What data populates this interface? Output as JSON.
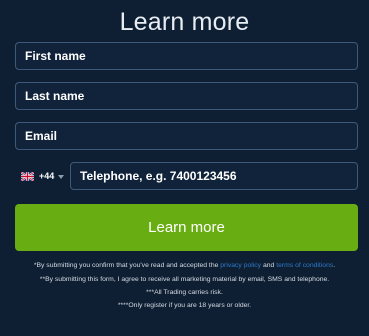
{
  "title": "Learn more",
  "form": {
    "first_name_placeholder": "First name",
    "last_name_placeholder": "Last name",
    "email_placeholder": "Email",
    "country_dial_code": "+44",
    "telephone_placeholder": "Telephone, e.g. 7400123456"
  },
  "submit_label": "Learn more",
  "disclaimer": {
    "line1_prefix": "*By submitting you confirm that you've read and accepted the ",
    "privacy_policy": "privacy policy",
    "line1_and": " and ",
    "terms": "terms of conditions",
    "line1_suffix": ".",
    "line2": "**By submitting this form, I agree to receive all marketing material by email, SMS and telephone.",
    "line3": "***All Trading carries risk.",
    "line4": "****Only register if you are 18 years or older."
  },
  "colors": {
    "background": "#0f1f33",
    "field_border": "#3f5a79",
    "accent": "#68ad12",
    "link": "#2d79c7"
  },
  "icons": {
    "flag": "uk-flag-icon",
    "caret": "chevron-down-icon"
  }
}
